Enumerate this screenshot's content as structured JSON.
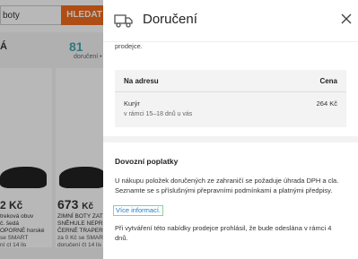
{
  "background": {
    "search_value": "boty",
    "search_button": "HLEDAT",
    "col_a_letter": "Á",
    "count_value": "81",
    "count_label": "doručení •",
    "products": [
      {
        "price": "2 Kč",
        "lines": [
          "treková obuv",
          "č. šedá",
          "OPORNÉ horské"
        ],
        "shipping": "se SMART",
        "delivery": "ní ct 14 lis"
      },
      {
        "price": "673",
        "price_unit": "Kč",
        "lines": [
          "ZIMNÍ BOTY ZAT",
          "SNĚHULE NEPR",
          "ČERNÉ TRAPER"
        ],
        "shipping": "za 0 Kč se SMART",
        "delivery": "doručení čt 14 lis"
      }
    ]
  },
  "drawer": {
    "title": "Doručení",
    "prodejce_text": "prodejce.",
    "table": {
      "col_left": "Na adresu",
      "col_right": "Cena",
      "rows": [
        {
          "name": "Kurýr",
          "sub": "v rámci 15–18 dnů u vás",
          "price": "264 Kč"
        }
      ]
    },
    "section": {
      "title": "Dovozní poplatky",
      "text": "U nákupu položek doručených ze zahraničí se požaduje úhrada DPH a cla. Seznamte se s příslušnými přepravními podmínkami a platnými předpisy.",
      "link": "Více informací.",
      "note": "Při vytváření této nabídky prodejce prohlásil, že bude odeslána v rámci 4 dnů."
    }
  }
}
